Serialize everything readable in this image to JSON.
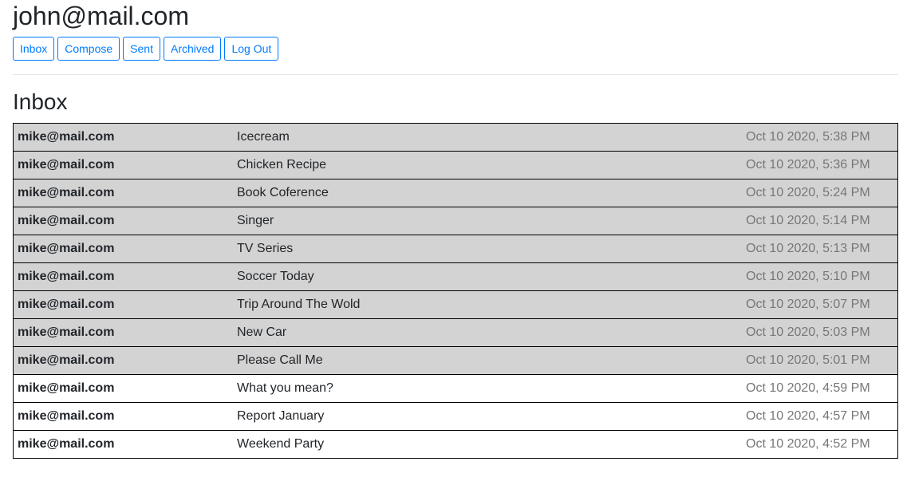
{
  "header": {
    "user_email": "john@mail.com"
  },
  "nav": {
    "inbox": "Inbox",
    "compose": "Compose",
    "sent": "Sent",
    "archived": "Archived",
    "logout": "Log Out"
  },
  "page": {
    "title": "Inbox"
  },
  "emails": [
    {
      "sender": "mike@mail.com",
      "subject": "Icecream",
      "timestamp": "Oct 10 2020, 5:38 PM",
      "read": true
    },
    {
      "sender": "mike@mail.com",
      "subject": "Chicken Recipe",
      "timestamp": "Oct 10 2020, 5:36 PM",
      "read": true
    },
    {
      "sender": "mike@mail.com",
      "subject": "Book Coference",
      "timestamp": "Oct 10 2020, 5:24 PM",
      "read": true
    },
    {
      "sender": "mike@mail.com",
      "subject": "Singer",
      "timestamp": "Oct 10 2020, 5:14 PM",
      "read": true
    },
    {
      "sender": "mike@mail.com",
      "subject": "TV Series",
      "timestamp": "Oct 10 2020, 5:13 PM",
      "read": true
    },
    {
      "sender": "mike@mail.com",
      "subject": "Soccer Today",
      "timestamp": "Oct 10 2020, 5:10 PM",
      "read": true
    },
    {
      "sender": "mike@mail.com",
      "subject": "Trip Around The Wold",
      "timestamp": "Oct 10 2020, 5:07 PM",
      "read": true
    },
    {
      "sender": "mike@mail.com",
      "subject": "New Car",
      "timestamp": "Oct 10 2020, 5:03 PM",
      "read": true
    },
    {
      "sender": "mike@mail.com",
      "subject": "Please Call Me",
      "timestamp": "Oct 10 2020, 5:01 PM",
      "read": true
    },
    {
      "sender": "mike@mail.com",
      "subject": "What you mean?",
      "timestamp": "Oct 10 2020, 4:59 PM",
      "read": false
    },
    {
      "sender": "mike@mail.com",
      "subject": "Report January",
      "timestamp": "Oct 10 2020, 4:57 PM",
      "read": false
    },
    {
      "sender": "mike@mail.com",
      "subject": "Weekend Party",
      "timestamp": "Oct 10 2020, 4:52 PM",
      "read": false
    }
  ],
  "colors": {
    "accent": "#007bff",
    "read_row_bg": "#d3d3d3",
    "unread_row_bg": "#ffffff",
    "timestamp": "#777777"
  }
}
